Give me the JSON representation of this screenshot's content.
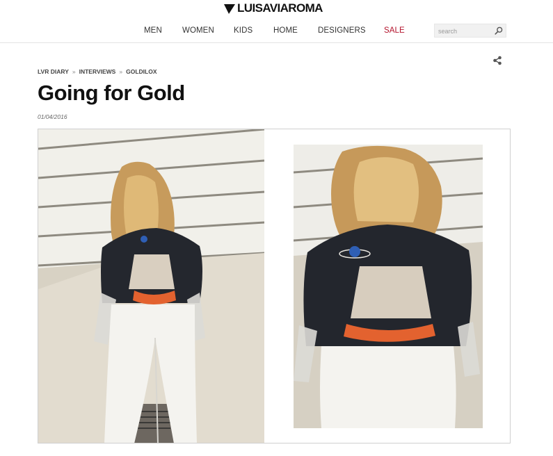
{
  "header": {
    "logo_text": "LUISAVIAROMA",
    "nav": [
      {
        "label": "MEN"
      },
      {
        "label": "WOMEN"
      },
      {
        "label": "KIDS"
      },
      {
        "label": "HOME"
      },
      {
        "label": "DESIGNERS"
      },
      {
        "label": "SALE",
        "highlight": true
      }
    ],
    "search": {
      "placeholder": "search",
      "value": "",
      "icon": "search-icon"
    }
  },
  "article": {
    "breadcrumb": [
      "LVR DIARY",
      "INTERVIEWS",
      "GOLDILOX"
    ],
    "breadcrumb_separator": "»",
    "title": "Going for Gold",
    "date": "01/04/2016",
    "share_icon": "share-icon"
  },
  "colors": {
    "sale": "#b3122b",
    "text": "#111111",
    "nav_text": "#333333"
  }
}
